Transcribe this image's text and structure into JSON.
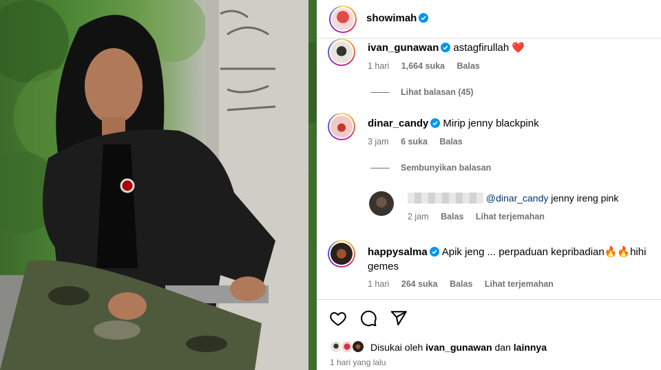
{
  "post": {
    "author": "showimah",
    "author_avatar_color": "#d9303e"
  },
  "comments": [
    {
      "user": "ivan_gunawan",
      "text": "astagfirullah",
      "emoji": "❤️",
      "age": "1 hari",
      "likes": "1,664 suka",
      "reply": "Balas",
      "thread_label": "Lihat balasan (45)"
    },
    {
      "user": "dinar_candy",
      "text": "Mirip jenny blackpink",
      "age": "3 jam",
      "likes": "6 suka",
      "reply": "Balas",
      "thread_label": "Sembunyikan balasan",
      "replies": [
        {
          "mention": "@dinar_candy",
          "text": "jenny ireng pink",
          "age": "2 jam",
          "reply": "Balas",
          "translate": "Lihat terjemahan"
        }
      ]
    },
    {
      "user": "happysalma",
      "text": "Apik jeng ... perpaduan kepribadian🔥🔥hihi",
      "text_line2": "gemes",
      "age": "1 hari",
      "likes": "264 suka",
      "reply": "Balas",
      "translate": "Lihat terjemahan"
    }
  ],
  "actions": {
    "icons": [
      "heart-icon",
      "comment-icon",
      "share-icon"
    ]
  },
  "likes_line": {
    "prefix": "Disukai oleh",
    "user": "ivan_gunawan",
    "connector": "dan",
    "others": "lainnya"
  },
  "timestamp": "1 hari yang lalu",
  "colors": {
    "verified": "#0095f6",
    "secondary_text": "#737373",
    "heart": "#ed4956",
    "mention": "#00376b"
  }
}
